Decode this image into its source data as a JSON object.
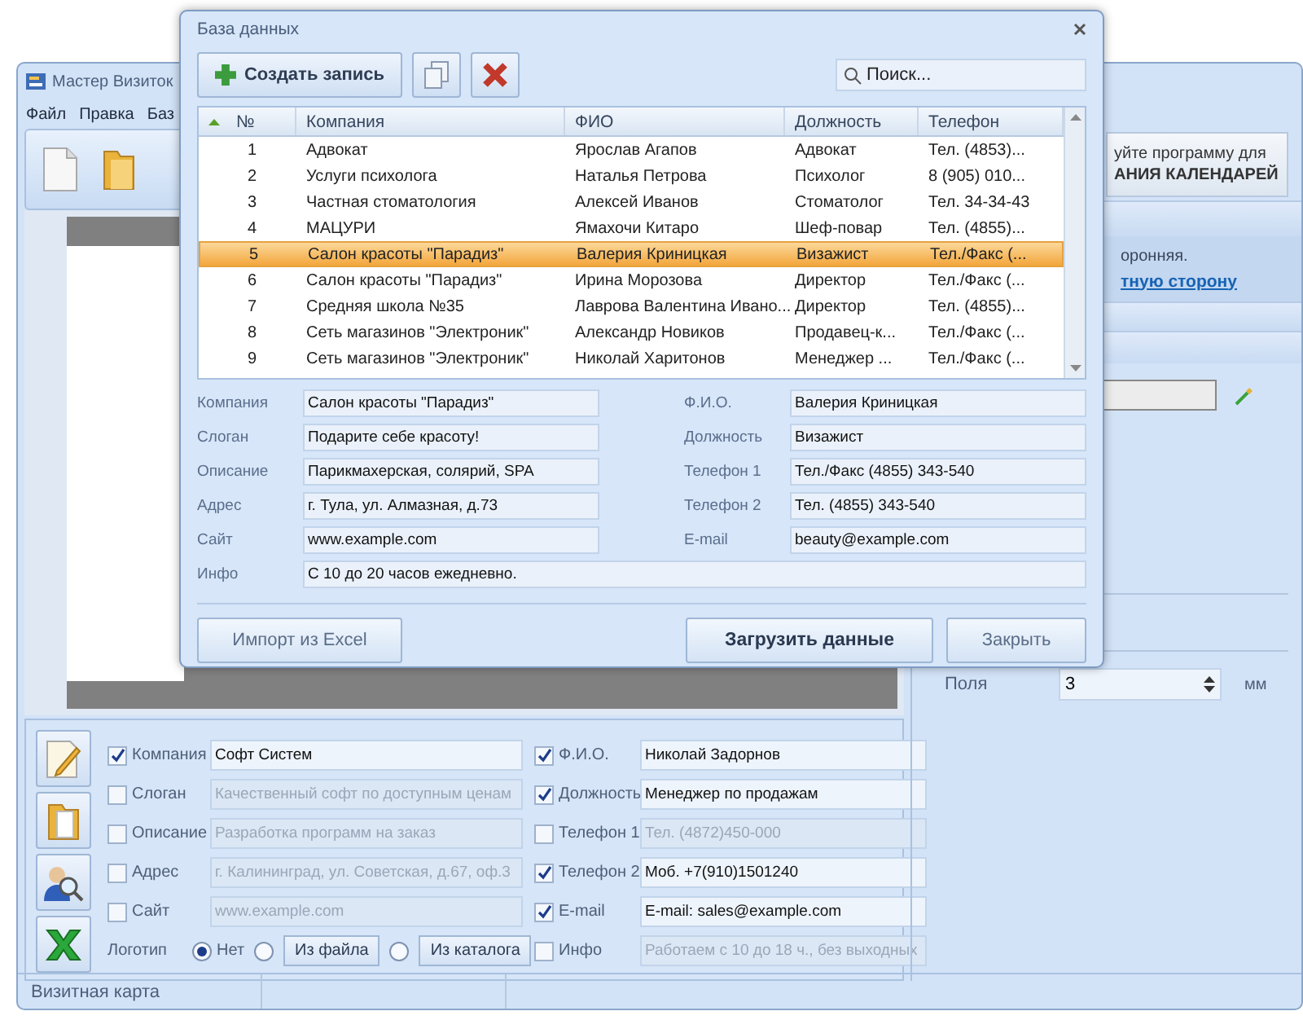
{
  "main_window": {
    "title": "Мастер Визиток",
    "menu": [
      "Файл",
      "Правка",
      "Баз"
    ]
  },
  "right_panel": {
    "promo_line1": "уйте программу для",
    "promo_line2": "АНИЯ КАЛЕНДАРЕЙ",
    "note": "оронняя.",
    "link": "тную сторону",
    "margins_label": "Поля",
    "margins_value": "3",
    "margins_unit": "мм"
  },
  "bottom_form": {
    "left_fields": [
      {
        "label": "Компания",
        "checked": true,
        "value": "Софт Систем"
      },
      {
        "label": "Слоган",
        "checked": false,
        "value": "Качественный софт по доступным ценам"
      },
      {
        "label": "Описание",
        "checked": false,
        "value": "Разработка программ на заказ"
      },
      {
        "label": "Адрес",
        "checked": false,
        "value": "г. Калининград, ул. Советская, д.67, оф.3"
      },
      {
        "label": "Сайт",
        "checked": false,
        "value": "www.example.com"
      }
    ],
    "right_fields": [
      {
        "label": "Ф.И.О.",
        "checked": true,
        "value": "Николай Задорнов"
      },
      {
        "label": "Должность",
        "checked": true,
        "value": "Менеджер по продажам"
      },
      {
        "label": "Телефон 1",
        "checked": false,
        "value": "Тел. (4872)450-000"
      },
      {
        "label": "Телефон 2",
        "checked": true,
        "value": "Моб. +7(910)1501240"
      },
      {
        "label": "E-mail",
        "checked": true,
        "value": "E-mail: sales@example.com"
      },
      {
        "label": "Инфо",
        "checked": false,
        "value": "Работаем с 10 до 18 ч., без выходных"
      }
    ],
    "logo": {
      "label": "Логотип",
      "options": [
        {
          "kind": "plain",
          "label": "Нет",
          "selected": true
        },
        {
          "kind": "button",
          "label": "Из файла",
          "selected": false
        },
        {
          "kind": "button",
          "label": "Из каталога",
          "selected": false
        }
      ]
    }
  },
  "status_bar": [
    "Визитная карта"
  ],
  "dialog": {
    "title": "База данных",
    "create_button": "Создать запись",
    "search": {
      "placeholder": "Поиск..."
    },
    "columns": [
      "№",
      "Компания",
      "ФИО",
      "Должность",
      "Телефон"
    ],
    "rows": [
      {
        "cells": [
          "1",
          "Адвокат",
          "Ярослав Агапов",
          "Адвокат",
          "Тел. (4853)..."
        ],
        "selected": false
      },
      {
        "cells": [
          "2",
          "Услуги психолога",
          "Наталья Петрова",
          "Психолог",
          "8 (905) 010..."
        ],
        "selected": false
      },
      {
        "cells": [
          "3",
          "Частная стоматология",
          "Алексей Иванов",
          "Стоматолог",
          "Тел. 34-34-43"
        ],
        "selected": false
      },
      {
        "cells": [
          "4",
          "МАЦУРИ",
          "Ямахочи Китаро",
          "Шеф-повар",
          "Тел. (4855)..."
        ],
        "selected": false
      },
      {
        "cells": [
          "5",
          "Салон красоты \"Парадиз\"",
          "Валерия Криницкая",
          "Визажист",
          "Тел./Факс (..."
        ],
        "selected": true
      },
      {
        "cells": [
          "6",
          "Салон красоты \"Парадиз\"",
          "Ирина Морозова",
          "Директор",
          "Тел./Факс (..."
        ],
        "selected": false
      },
      {
        "cells": [
          "7",
          "Средняя школа №35",
          "Лаврова Валентина Ивано...",
          "Директор",
          "Тел. (4855)..."
        ],
        "selected": false
      },
      {
        "cells": [
          "8",
          "Сеть магазинов \"Электроник\"",
          "Александр Новиков",
          "Продавец-к...",
          "Тел./Факс (..."
        ],
        "selected": false
      },
      {
        "cells": [
          "9",
          "Сеть магазинов \"Электроник\"",
          "Николай Харитонов",
          "Менеджер ...",
          "Тел./Факс (..."
        ],
        "selected": false
      }
    ],
    "details": {
      "left": [
        {
          "label": "Компания",
          "value": "Салон красоты \"Парадиз\""
        },
        {
          "label": "Слоган",
          "value": "Подарите себе красоту!"
        },
        {
          "label": "Описание",
          "value": "Парикмахерская, солярий, SPA"
        },
        {
          "label": "Адрес",
          "value": "г. Тула, ул. Алмазная, д.73"
        },
        {
          "label": "Сайт",
          "value": "www.example.com"
        }
      ],
      "right": [
        {
          "label": "Ф.И.О.",
          "value": "Валерия Криницкая"
        },
        {
          "label": "Должность",
          "value": "Визажист"
        },
        {
          "label": "Телефон 1",
          "value": "Тел./Факс (4855) 343-540"
        },
        {
          "label": "Телефон 2",
          "value": "Тел. (4855) 343-540"
        },
        {
          "label": "E-mail",
          "value": "beauty@example.com"
        }
      ],
      "info": {
        "label": "Инфо",
        "value": "С 10 до 20 часов ежедневно."
      }
    },
    "buttons": {
      "import": "Импорт из Excel",
      "load": "Загрузить данные",
      "close": "Закрыть"
    }
  }
}
